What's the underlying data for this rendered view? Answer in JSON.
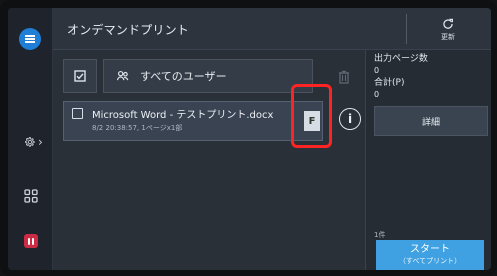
{
  "header": {
    "title": "オンデマンドプリント",
    "refresh_label": "更新"
  },
  "filters": {
    "user_filter_label": "すべてのユーザー"
  },
  "jobs": [
    {
      "name": "Microsoft Word - テストプリント.docx",
      "meta": "8/2 20:38:57, 1ページx1部",
      "format_badge": "F"
    }
  ],
  "summary": {
    "output_pages_label": "出力ページ数",
    "output_pages_value": "0",
    "total_label": "合計(P)",
    "total_value": "0",
    "details_label": "詳細",
    "count_label": "1件"
  },
  "actions": {
    "start_label": "スタート",
    "start_sub_label": "（すべてプリント）"
  },
  "colors": {
    "accent": "#3fa1e1",
    "menu": "#1f7ed6",
    "stop": "#cc2b45",
    "highlight": "#ff2424"
  },
  "icons": {
    "menu": "menu-icon",
    "settings": "gear-icon",
    "apps": "apps-grid-icon",
    "stop": "pause-icon",
    "refresh": "refresh-icon",
    "select_all": "checkbox-icon",
    "users": "users-icon",
    "delete": "trash-icon",
    "info": "info-icon"
  }
}
